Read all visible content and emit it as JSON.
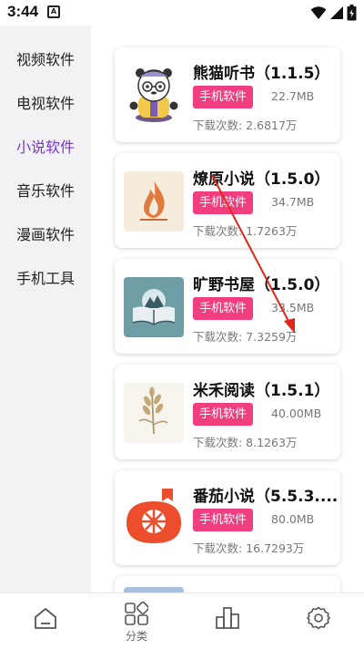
{
  "status_bar": {
    "time": "3:44",
    "notification_letter": "A"
  },
  "sidebar": {
    "items": [
      {
        "label": "视频软件"
      },
      {
        "label": "电视软件"
      },
      {
        "label": "小说软件",
        "active": true
      },
      {
        "label": "音乐软件"
      },
      {
        "label": "漫画软件"
      },
      {
        "label": "手机工具"
      }
    ],
    "active_color": "#7b35c9"
  },
  "apps": [
    {
      "title": "熊猫听书（1.1.5）",
      "category": "手机软件",
      "size": "22.7MB",
      "downloads": "下载次数: 2.6817万",
      "icon": "panda-icon"
    },
    {
      "title": "燎原小说（1.5.0）",
      "category": "手机软件",
      "size": "34.7MB",
      "downloads": "下载次数: 1.7263万",
      "icon": "flame-icon"
    },
    {
      "title": "旷野书屋（1.5.0）",
      "category": "手机软件",
      "size": "33.5MB",
      "downloads": "下载次数: 7.3259万",
      "icon": "book-icon"
    },
    {
      "title": "米禾阅读（1.5.1）",
      "category": "手机软件",
      "size": "40.00MB",
      "downloads": "下载次数: 8.1263万",
      "icon": "wheat-icon"
    },
    {
      "title": "番茄小说（5.5.3....",
      "category": "手机软件",
      "size": "80.0MB",
      "downloads": "下载次数: 16.7293万",
      "icon": "tomato-icon"
    }
  ],
  "badge_color": "#f23e7f",
  "bottom_nav": {
    "items": [
      {
        "icon": "home-icon",
        "label": ""
      },
      {
        "icon": "category-icon",
        "label": "分类"
      },
      {
        "icon": "ranking-icon",
        "label": ""
      },
      {
        "icon": "settings-icon",
        "label": ""
      }
    ]
  },
  "annotation": {
    "arrow_color": "#e0261b"
  }
}
